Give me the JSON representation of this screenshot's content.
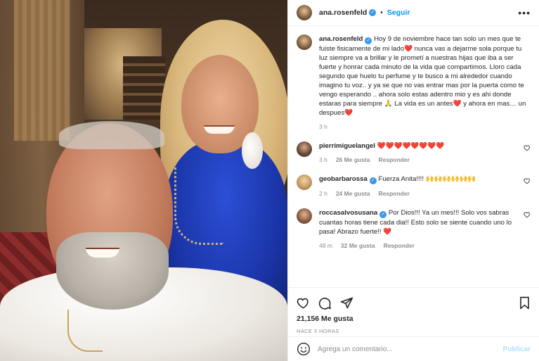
{
  "post": {
    "photo_alt": "",
    "username": "ana.rosenfeld",
    "follow_label": "Seguir",
    "more_label": "•••"
  },
  "caption": {
    "username": "ana.rosenfeld",
    "text_part1": "Hoy 9 de noviembre hace tan solo un mes que te fuiste fisicamente de mi lado",
    "heart1": "❤️",
    "text_part2": " nunca vas a dejarme sola porque tu luz siempre va a brillar y le prometí a nuestras hijas que iba a ser fuerte y honrar cada minuto de la vida que compartimos. Lloro cada segundo que huelo tu perfume y te busco a mi alrededor cuando imagino tu voz.. y ya se que no vas entrar mas por la puerta como te vengo esperando .. ahora solo estas adentro mio y es ahi donde estaras para siempre ",
    "pray": "🙏",
    "text_part3": " La vida es un antes",
    "heart2": "❤️",
    "text_part4": " y ahora en mas… un despues",
    "heart3": "❤️",
    "time": "3 h"
  },
  "comments": [
    {
      "username": "pierrimiguelangel",
      "verified": false,
      "text": "❤️❤️❤️❤️❤️❤️❤️❤️",
      "time": "3 h",
      "likes": "26 Me gusta",
      "reply": "Responder"
    },
    {
      "username": "geobarbarossa",
      "verified": true,
      "text": "Fuerza Anita!!!! ",
      "emojis": "🙌🙌🙌🙌🙌🙌",
      "time": "2 h",
      "likes": "24 Me gusta",
      "reply": "Responder"
    },
    {
      "username": "roccasalvosusana",
      "verified": true,
      "text": "Por Dios!!! Ya un mes!!! Solo vos sabras cuantas horas tiene cada dia!! Esto solo se siente cuando uno lo pasa! Abrazo fuerte!! ",
      "heart": "❤️",
      "time": "48 m",
      "likes": "32 Me gusta",
      "reply": "Responder"
    }
  ],
  "stats": {
    "likes": "21,156 Me gusta",
    "posted": "HACE 3 HORAS"
  },
  "add_comment": {
    "placeholder": "Agrega un comentario...",
    "publish_label": "Publicar"
  },
  "colors": {
    "link_blue": "#0095f6",
    "verified_blue": "#3897f0",
    "heart_red": "#ed4956",
    "muted": "#8e8e8e",
    "publish_disabled": "#b2dffc"
  }
}
